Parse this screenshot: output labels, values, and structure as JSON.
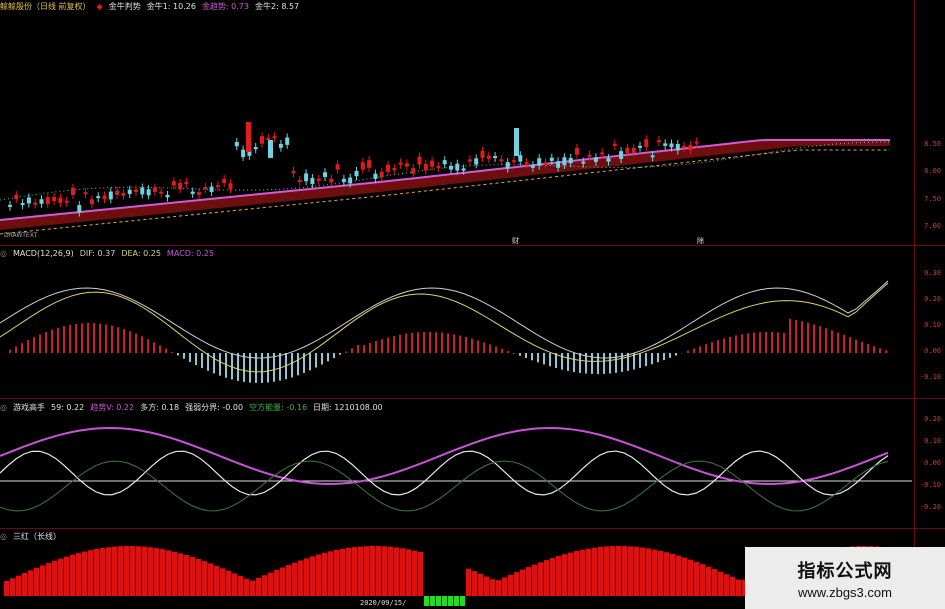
{
  "colors": {
    "up": "#e21b1b",
    "down": "#6fd3e0",
    "ma": "#d05cd8",
    "band": "#7a1010",
    "dash": "#e8a93c",
    "macd_dif": "#cfcfcf",
    "macd_dea": "#e0d070",
    "hist_up": "#c22",
    "hist_down": "#8fc6d6",
    "magenta": "#c853d8",
    "white": "#e8e8e8",
    "green": "#3c7a3c",
    "bar_red": "#e01010",
    "bar_green": "#22dd22"
  },
  "panel1": {
    "title": "鲸鲸殷份（日线 前复权）",
    "indicator": "金牛判势",
    "items": [
      {
        "label": "金牛1:",
        "value": "10.26",
        "color": "#e0e0e0"
      },
      {
        "label": "金趋势:",
        "value": "0.73",
        "color": "#d05cd8"
      },
      {
        "label": "金牛2:",
        "value": "8.57",
        "color": "#e0e0e0"
      }
    ],
    "y_ticks": [
      "8.50",
      "8.00",
      "7.50",
      "7.00"
    ],
    "bottom_label": "DRAWTEXT",
    "markers": [
      "财",
      "除"
    ]
  },
  "panel2": {
    "title": "MACD(12,26,9)",
    "items": [
      {
        "label": "DIF:",
        "value": "0.37",
        "color": "#cfcfcf"
      },
      {
        "label": "DEA:",
        "value": "0.25",
        "color": "#e0d070"
      },
      {
        "label": "MACD:",
        "value": "0.25",
        "color": "#c853d8"
      }
    ],
    "y_ticks": [
      "0.30",
      "0.20",
      "0.10",
      "0.00",
      "-0.10"
    ]
  },
  "panel3": {
    "title": "游戏高手",
    "items": [
      {
        "label": "59:",
        "value": "0.22",
        "color": "#e0e0e0"
      },
      {
        "label": "趋势V:",
        "value": "0.22",
        "color": "#c853d8"
      },
      {
        "label": "多方:",
        "value": "0.18",
        "color": "#e0e0e0"
      },
      {
        "label": "强弱分界:",
        "value": "-0.00",
        "color": "#e0e0e0"
      },
      {
        "label": "空方能量:",
        "value": "-0.16",
        "color": "#3cb43c"
      },
      {
        "label": "日期:",
        "value": "1210108.00",
        "color": "#e0e0e0"
      }
    ],
    "y_ticks": [
      "0.20",
      "0.10",
      "0.00",
      "-0.10",
      "-0.20"
    ]
  },
  "panel4": {
    "title": "三红（长线）"
  },
  "date_label": "2020/09/15/",
  "watermark": {
    "line1": "指标公式网",
    "line2": "www.zbgs3.com"
  }
}
